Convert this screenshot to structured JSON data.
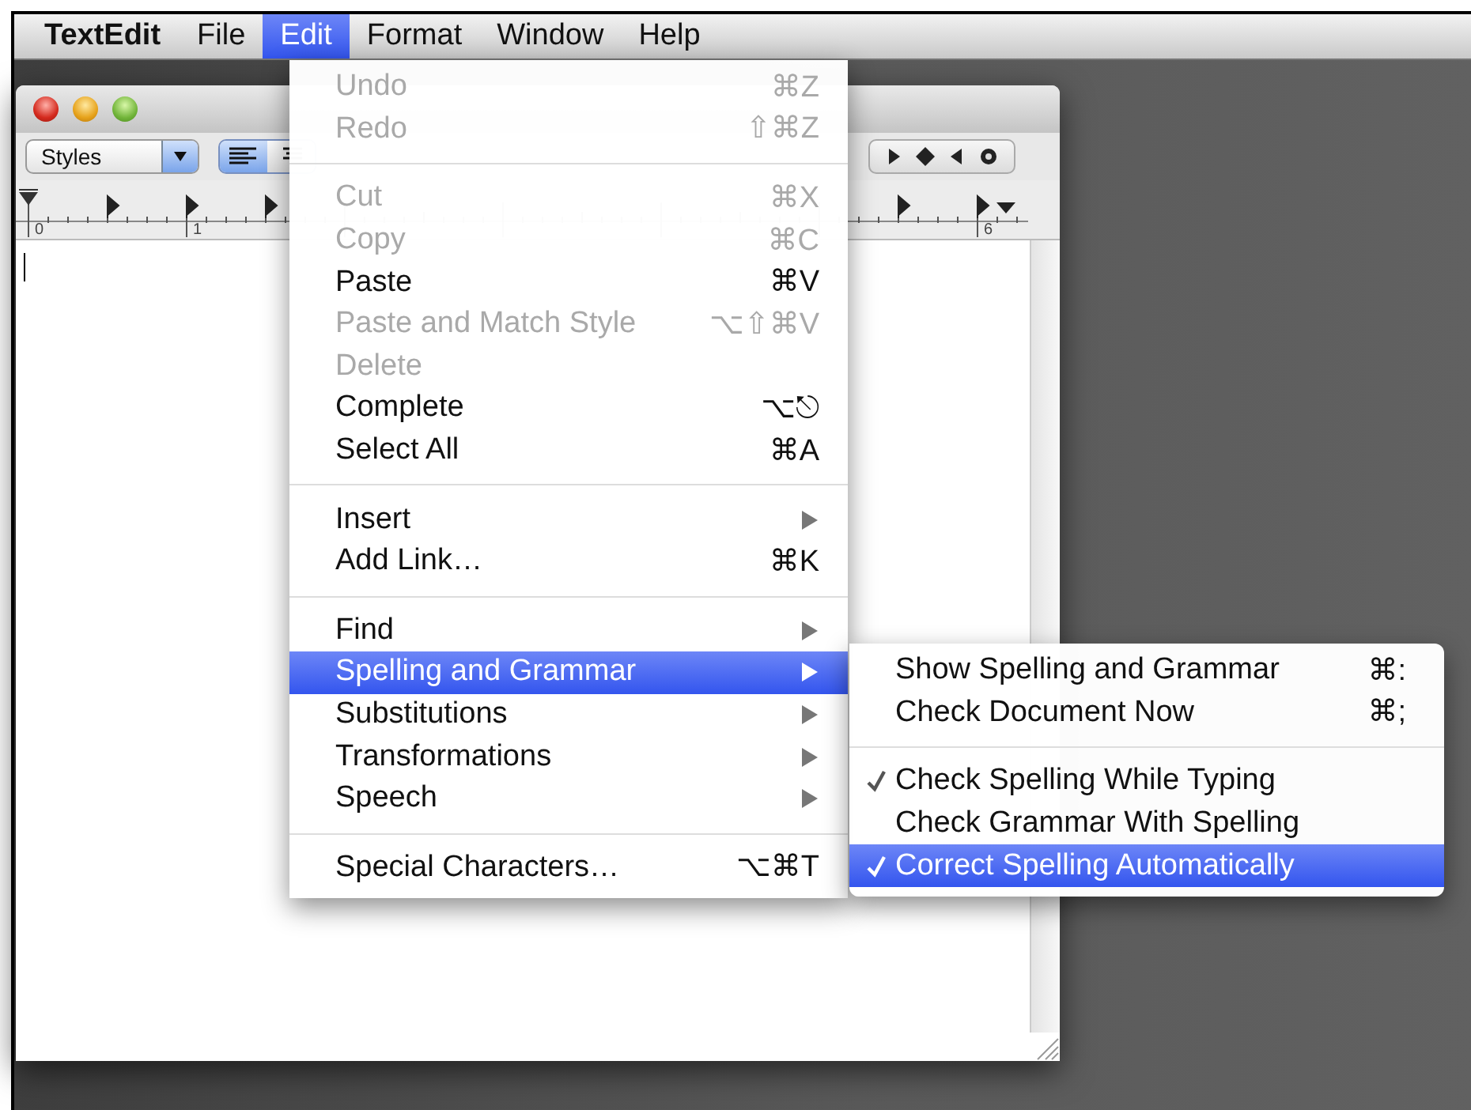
{
  "menubar": {
    "items": [
      {
        "label": "TextEdit",
        "kind": "app",
        "selected": false
      },
      {
        "label": "File",
        "kind": "menu",
        "selected": false
      },
      {
        "label": "Edit",
        "kind": "menu",
        "selected": true
      },
      {
        "label": "Format",
        "kind": "menu",
        "selected": false
      },
      {
        "label": "Window",
        "kind": "menu",
        "selected": false
      },
      {
        "label": "Help",
        "kind": "menu",
        "selected": false
      }
    ]
  },
  "window": {
    "toolbar": {
      "styles_popup": "Styles"
    },
    "ruler": {
      "labels": [
        "0",
        "1",
        "6"
      ]
    }
  },
  "edit_menu": {
    "items": [
      {
        "kind": "item",
        "label": "Undo",
        "shortcut": "⌘Z",
        "disabled": true,
        "submenu": false,
        "selected": false
      },
      {
        "kind": "item",
        "label": "Redo",
        "shortcut": "⇧⌘Z",
        "disabled": true,
        "submenu": false,
        "selected": false
      },
      {
        "kind": "separator"
      },
      {
        "kind": "item",
        "label": "Cut",
        "shortcut": "⌘X",
        "disabled": true,
        "submenu": false,
        "selected": false
      },
      {
        "kind": "item",
        "label": "Copy",
        "shortcut": "⌘C",
        "disabled": true,
        "submenu": false,
        "selected": false
      },
      {
        "kind": "item",
        "label": "Paste",
        "shortcut": "⌘V",
        "disabled": false,
        "submenu": false,
        "selected": false
      },
      {
        "kind": "item",
        "label": "Paste and Match Style",
        "shortcut": "⌥⇧⌘V",
        "disabled": true,
        "submenu": false,
        "selected": false
      },
      {
        "kind": "item",
        "label": "Delete",
        "disabled": true,
        "submenu": false,
        "selected": false
      },
      {
        "kind": "item",
        "label": "Complete",
        "shortcut": "⌥⎋",
        "disabled": false,
        "submenu": false,
        "selected": false
      },
      {
        "kind": "item",
        "label": "Select All",
        "shortcut": "⌘A",
        "disabled": false,
        "submenu": false,
        "selected": false
      },
      {
        "kind": "separator"
      },
      {
        "kind": "item",
        "label": "Insert",
        "disabled": false,
        "submenu": true,
        "selected": false
      },
      {
        "kind": "item",
        "label": "Add Link…",
        "shortcut": "⌘K",
        "disabled": false,
        "submenu": false,
        "selected": false
      },
      {
        "kind": "separator"
      },
      {
        "kind": "item",
        "label": "Find",
        "disabled": false,
        "submenu": true,
        "selected": false
      },
      {
        "kind": "item",
        "label": "Spelling and Grammar",
        "disabled": false,
        "submenu": true,
        "selected": true
      },
      {
        "kind": "item",
        "label": "Substitutions",
        "disabled": false,
        "submenu": true,
        "selected": false
      },
      {
        "kind": "item",
        "label": "Transformations",
        "disabled": false,
        "submenu": true,
        "selected": false
      },
      {
        "kind": "item",
        "label": "Speech",
        "disabled": false,
        "submenu": true,
        "selected": false
      },
      {
        "kind": "separator"
      },
      {
        "kind": "item",
        "label": "Special Characters…",
        "shortcut": "⌥⌘T",
        "disabled": false,
        "submenu": false,
        "selected": false
      }
    ]
  },
  "spelling_submenu": {
    "items": [
      {
        "kind": "item",
        "label": "Show Spelling and Grammar",
        "shortcut": "⌘:",
        "checked": false,
        "selected": false
      },
      {
        "kind": "item",
        "label": "Check Document Now",
        "shortcut": "⌘;",
        "checked": false,
        "selected": false
      },
      {
        "kind": "separator"
      },
      {
        "kind": "item",
        "label": "Check Spelling While Typing",
        "checked": true,
        "selected": false
      },
      {
        "kind": "item",
        "label": "Check Grammar With Spelling",
        "checked": false,
        "selected": false
      },
      {
        "kind": "item",
        "label": "Correct Spelling Automatically",
        "checked": true,
        "selected": true
      }
    ]
  }
}
